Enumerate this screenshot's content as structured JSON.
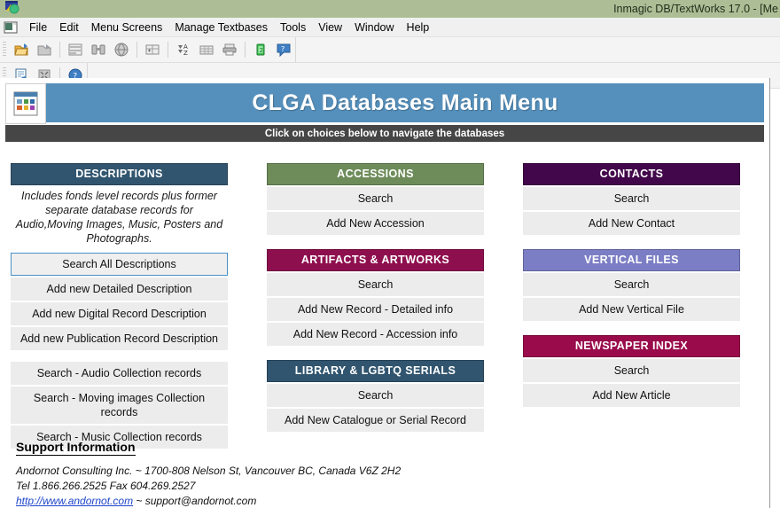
{
  "window": {
    "title": "Inmagic DB/TextWorks 17.0  - [Me",
    "icon": "app-window-icon"
  },
  "menubar": {
    "doc_icon": "document-window-icon",
    "items": [
      {
        "label": "File"
      },
      {
        "label": "Edit"
      },
      {
        "label": "Menu Screens"
      },
      {
        "label": "Manage Textbases"
      },
      {
        "label": "Tools"
      },
      {
        "label": "View"
      },
      {
        "label": "Window"
      },
      {
        "label": "Help"
      }
    ]
  },
  "toolbar_primary": {
    "buttons": [
      {
        "icon": "open-textbase-icon"
      },
      {
        "icon": "close-textbase-icon"
      },
      {
        "icon": "new-record-icon"
      },
      {
        "icon": "find-binoculars-icon"
      },
      {
        "icon": "globe-search-icon"
      },
      {
        "icon": "edit-table-icon"
      },
      {
        "icon": "sort-az-icon"
      },
      {
        "icon": "report-grid-icon"
      },
      {
        "icon": "print-icon"
      },
      {
        "icon": "batch-modify-icon"
      },
      {
        "icon": "help-question-icon"
      }
    ]
  },
  "toolbar_secondary": {
    "buttons": [
      {
        "icon": "form-edit-icon"
      },
      {
        "icon": "expand-window-icon"
      },
      {
        "icon": "help-circle-icon"
      }
    ]
  },
  "banner": {
    "icon": "menu-screen-icon",
    "title": "CLGA Databases Main Menu",
    "subtitle": "Click on choices below to navigate the databases",
    "banner_color": "#5590bc",
    "subtitle_color": "#464646"
  },
  "columns": [
    {
      "sections": [
        {
          "id": "descriptions",
          "title": "DESCRIPTIONS",
          "color": "#31556f",
          "description": "Includes fonds level records plus former separate database records for Audio,Moving Images, Music, Posters and Photographs.",
          "buttons": [
            {
              "label": "Search All Descriptions",
              "focused": true
            },
            {
              "label": "Add new Detailed Description",
              "focused": false
            },
            {
              "label": "Add new Digital Record Description",
              "focused": false
            },
            {
              "label": "Add new Publication Record Description",
              "focused": false
            },
            {
              "label": "Search - Audio Collection records",
              "focused": false,
              "spaced": true
            },
            {
              "label": "Search - Moving images Collection records",
              "focused": false
            },
            {
              "label": "Search - Music Collection records",
              "focused": false
            }
          ]
        }
      ]
    },
    {
      "sections": [
        {
          "id": "accessions",
          "title": "ACCESSIONS",
          "color": "#6e8c5a",
          "buttons": [
            {
              "label": "Search",
              "focused": false
            },
            {
              "label": "Add New Accession",
              "focused": false
            }
          ]
        },
        {
          "id": "artifacts-artworks",
          "title": "ARTIFACTS & ARTWORKS",
          "color": "#8e0f4e",
          "buttons": [
            {
              "label": "Search",
              "focused": false
            },
            {
              "label": "Add New Record - Detailed info",
              "focused": false
            },
            {
              "label": "Add New Record - Accession info",
              "focused": false
            }
          ]
        },
        {
          "id": "library-lgbtq-serials",
          "title": "LIBRARY & LGBTQ SERIALS",
          "color": "#31556f",
          "buttons": [
            {
              "label": "Search",
              "focused": false
            },
            {
              "label": "Add New Catalogue or Serial Record",
              "focused": false
            }
          ]
        }
      ]
    },
    {
      "sections": [
        {
          "id": "contacts",
          "title": "CONTACTS",
          "color": "#42064a",
          "buttons": [
            {
              "label": "Search",
              "focused": false
            },
            {
              "label": "Add New Contact",
              "focused": false
            }
          ]
        },
        {
          "id": "vertical-files",
          "title": "VERTICAL FILES",
          "color": "#7b7ec4",
          "buttons": [
            {
              "label": "Search",
              "focused": false
            },
            {
              "label": "Add New Vertical File",
              "focused": false
            }
          ]
        },
        {
          "id": "newspaper-index",
          "title": "NEWSPAPER INDEX",
          "color": "#9a0b4b",
          "buttons": [
            {
              "label": "Search",
              "focused": false
            },
            {
              "label": "Add New Article",
              "focused": false
            }
          ]
        }
      ]
    }
  ],
  "support": {
    "heading": "Support Information",
    "line1": "Andornot Consulting Inc. ~ 1700-808 Nelson St, Vancouver BC, Canada V6Z 2H2",
    "line2": "Tel 1.866.266.2525  Fax 604.269.2527",
    "link_text": "http://www.andornot.com",
    "line3_suffix": " ~ support@andornot.com"
  }
}
